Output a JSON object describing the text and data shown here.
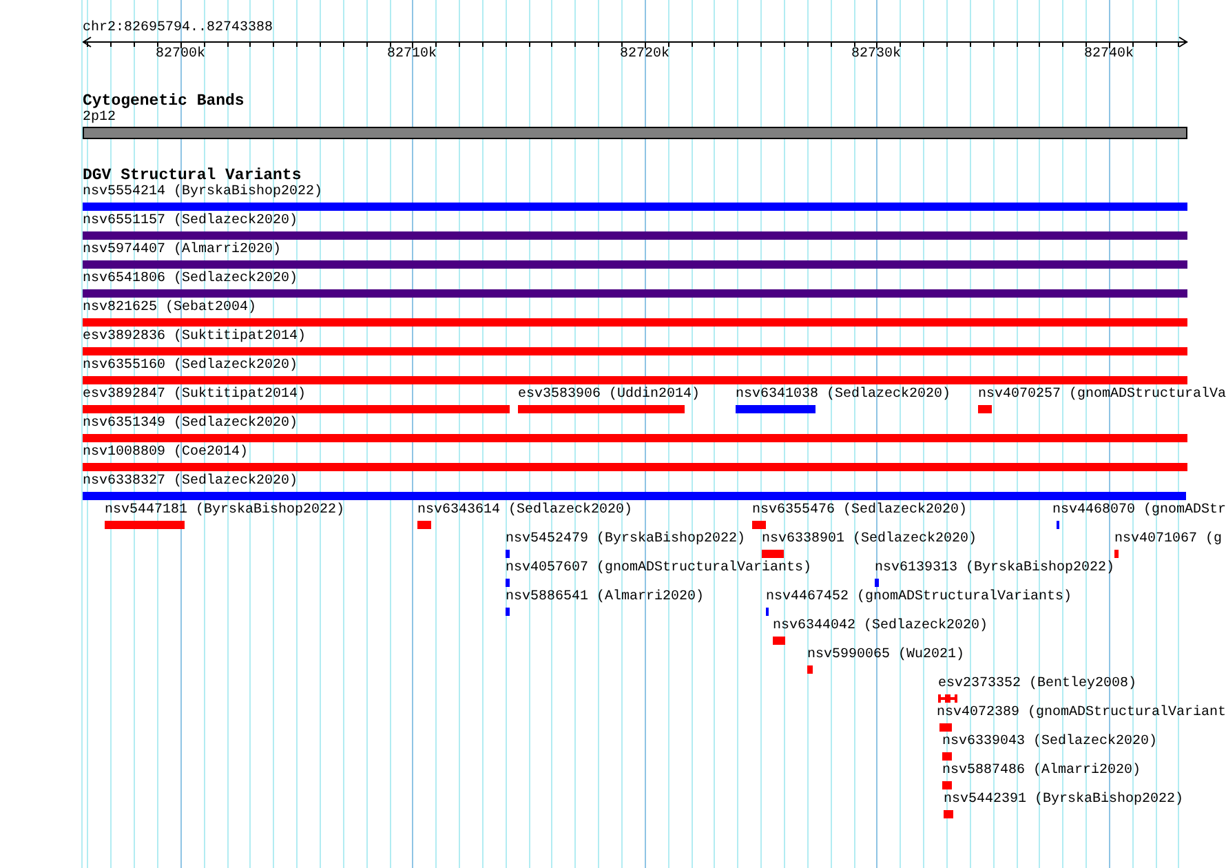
{
  "ruler": {
    "location": "chr2:82695794..82743388",
    "ticks": [
      "82700k",
      "82710k",
      "82720k",
      "82730k",
      "82740k"
    ]
  },
  "cytogenetic_bands": {
    "title": "Cytogenetic Bands",
    "bands": [
      {
        "label": "2p12"
      }
    ]
  },
  "dgv_structural_variants": {
    "title": "DGV Structural Variants",
    "variants": [
      {
        "label": "nsv5554214 (ByrskaBishop2022)",
        "color": "#0000ff",
        "kind": "block"
      },
      {
        "label": "nsv6551157 (Sedlazeck2020)",
        "color": "#4b0082",
        "kind": "block"
      },
      {
        "label": "nsv5974407 (Almarri2020)",
        "color": "#4b0082",
        "kind": "block"
      },
      {
        "label": "nsv6541806 (Sedlazeck2020)",
        "color": "#4b0082",
        "kind": "block"
      },
      {
        "label": "nsv821625 (Sebat2004)",
        "color": "#ff0000",
        "kind": "block"
      },
      {
        "label": "esv3892836 (Suktitipat2014)",
        "color": "#ff0000",
        "kind": "block"
      },
      {
        "label": "nsv6355160 (Sedlazeck2020)",
        "color": "#ff0000",
        "kind": "block"
      },
      {
        "label": "esv3892847 (Suktitipat2014)",
        "color": "#ff0000",
        "kind": "block"
      },
      {
        "label": "esv3583906 (Uddin2014)",
        "color": "#ff0000",
        "kind": "block"
      },
      {
        "label": "nsv6341038 (Sedlazeck2020)",
        "color": "#0000ff",
        "kind": "block"
      },
      {
        "label": "nsv4070257 (gnomADStructuralVa",
        "color": "#ff0000",
        "kind": "block"
      },
      {
        "label": "nsv6351349 (Sedlazeck2020)",
        "color": "#ff0000",
        "kind": "block"
      },
      {
        "label": "nsv1008809 (Coe2014)",
        "color": "#ff0000",
        "kind": "block"
      },
      {
        "label": "nsv6338327 (Sedlazeck2020)",
        "color": "#0000ff",
        "kind": "block"
      },
      {
        "label": "nsv5447181 (ByrskaBishop2022)",
        "color": "#ff0000",
        "kind": "block"
      },
      {
        "label": "nsv6343614 (Sedlazeck2020)",
        "color": "#ff0000",
        "kind": "block"
      },
      {
        "label": "nsv6355476 (Sedlazeck2020)",
        "color": "#ff0000",
        "kind": "block"
      },
      {
        "label": "nsv4468070 (gnomADStr",
        "color": "#0000ff",
        "kind": "block"
      },
      {
        "label": "nsv5452479 (ByrskaBishop2022)",
        "color": "#0000ff",
        "kind": "block"
      },
      {
        "label": "nsv6338901 (Sedlazeck2020)",
        "color": "#ff0000",
        "kind": "block"
      },
      {
        "label": "nsv4071067 (g",
        "color": "#ff0000",
        "kind": "block"
      },
      {
        "label": "nsv4057607 (gnomADStructuralVariants)",
        "color": "#0000ff",
        "kind": "block"
      },
      {
        "label": "nsv6139313 (ByrskaBishop2022)",
        "color": "#0000ff",
        "kind": "block"
      },
      {
        "label": "nsv5886541 (Almarri2020)",
        "color": "#0000ff",
        "kind": "block"
      },
      {
        "label": "nsv4467452 (gnomADStructuralVariants)",
        "color": "#0000ff",
        "kind": "block"
      },
      {
        "label": "nsv6344042 (Sedlazeck2020)",
        "color": "#ff0000",
        "kind": "block"
      },
      {
        "label": "nsv5990065 (Wu2021)",
        "color": "#ff0000",
        "kind": "block"
      },
      {
        "label": "esv2373352 (Bentley2008)",
        "color": "#ff0000",
        "kind": "segmented"
      },
      {
        "label": "nsv4072389 (gnomADStructuralVariant",
        "color": "#ff0000",
        "kind": "block"
      },
      {
        "label": "nsv6339043 (Sedlazeck2020)",
        "color": "#ff0000",
        "kind": "block"
      },
      {
        "label": "nsv5887486 (Almarri2020)",
        "color": "#ff0000",
        "kind": "block"
      },
      {
        "label": "nsv5442391 (ByrskaBishop2022)",
        "color": "#ff0000",
        "kind": "block"
      }
    ]
  }
}
